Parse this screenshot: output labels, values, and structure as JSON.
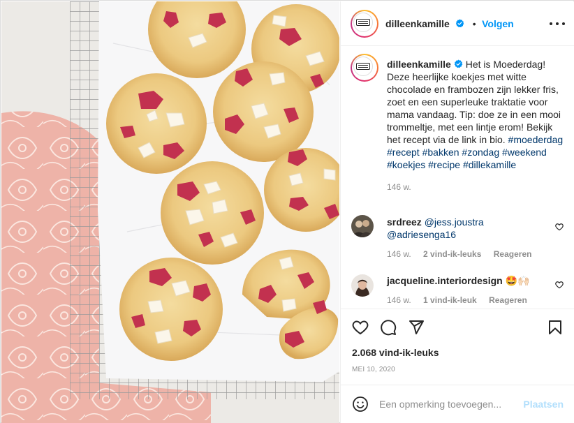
{
  "post": {
    "account": "dilleenkamille",
    "follow_label": "Volgen",
    "dot": "•",
    "logo_text": "DILLE & KAMILLE"
  },
  "caption": {
    "username": "dilleenkamille",
    "text": "Het is Moederdag! Deze heerlijke koekjes met witte chocolade en frambozen zijn lekker fris, zoet en een superleuke traktatie voor mama vandaag. Tip: doe ze in een mooi trommeltje, met een lintje erom! Bekijk het recept via de link in bio. ",
    "hashtags": "#moederdag #recept #bakken #zondag #weekend #koekjes #recipe #dillekamille",
    "age": "146 w."
  },
  "comments": [
    {
      "username": "srdreez",
      "mention_1": "@jess.joustra",
      "mention_2": "@adriesenga16",
      "age": "146 w.",
      "likes": "2 vind-ik-leuks",
      "reply": "Reageren"
    },
    {
      "username": "jacqueline.interiordesign",
      "emoji": "🤩🙌🏻",
      "age": "146 w.",
      "likes": "1 vind-ik-leuk",
      "reply": "Reageren"
    }
  ],
  "actions": {
    "icons": [
      "heart-icon",
      "comment-icon",
      "share-icon",
      "bookmark-icon"
    ],
    "likes_count": "2.068 vind-ik-leuks",
    "date": "MEI 10, 2020"
  },
  "add_comment": {
    "placeholder": "Een opmerking toevoegen...",
    "post_label": "Plaatsen"
  },
  "colors": {
    "link_blue": "#0095f6",
    "hashtag_blue": "#00376b",
    "muted": "#8e8e8e",
    "post_disabled": "#b2dffc"
  }
}
